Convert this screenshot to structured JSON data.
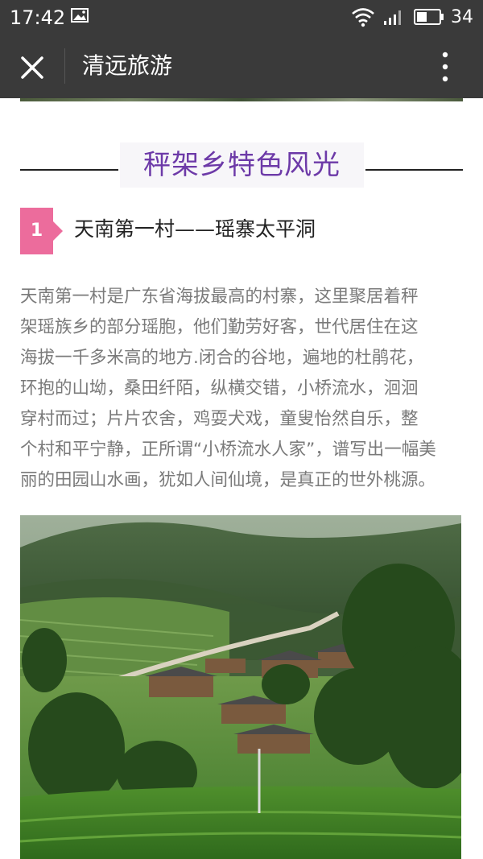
{
  "status_bar": {
    "time": "17:42",
    "battery_level": "34",
    "icons": [
      "image-icon",
      "wifi-icon",
      "signal-icon",
      "battery-icon"
    ]
  },
  "nav_bar": {
    "title": "清远旅游",
    "close_icon": "close-icon",
    "more_icon": "more-vertical-icon"
  },
  "article": {
    "section_title": "秤架乡特色风光",
    "item_number": "1",
    "item_title": "天南第一村——瑶寨太平洞",
    "paragraph_lines": [
      "天南第一村是广东省海拔最高的村寨，这里聚居着秤",
      "架瑶族乡的部分瑶胞，他们勤劳好客，世代居住在这",
      "海拔一千多米高的地方.闭合的谷地，遍地的杜鹃花，",
      "环抱的山坳，桑田纤陌，纵横交错，小桥流水，洄洄",
      "穿村而过；片片农舍，鸡耍犬戏，童叟怡然自乐，整",
      "个村和平宁静，正所谓“小桥流水人家”，谱写出一幅美",
      "丽的田园山水画，犹如人间仙境，是真正的世外桃源。"
    ]
  },
  "colors": {
    "bar_background": "#3a3a3a",
    "section_title": "#6d3aa8",
    "badge": "#ec6c9c",
    "paragraph_text": "#7a7a7a"
  }
}
